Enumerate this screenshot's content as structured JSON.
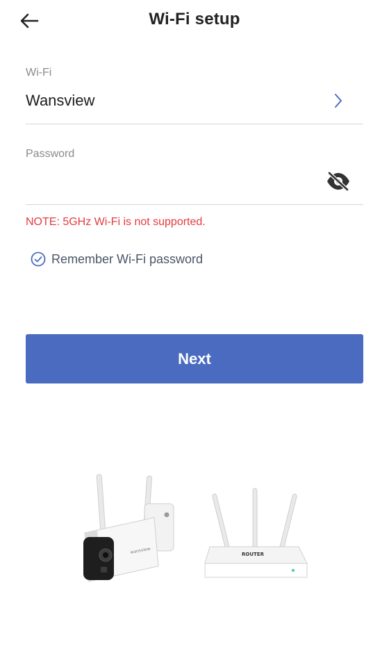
{
  "header": {
    "title": "Wi-Fi setup"
  },
  "wifi": {
    "label": "Wi-Fi",
    "value": "Wansview"
  },
  "password": {
    "label": "Password",
    "value": ""
  },
  "note": "NOTE: 5GHz Wi-Fi is not supported.",
  "remember": {
    "label": "Remember Wi-Fi password",
    "checked": true
  },
  "next_button": {
    "label": "Next"
  },
  "illustration": {
    "camera_brand": "wansview",
    "router_text": "ROUTER"
  },
  "colors": {
    "accent": "#4b6bc1",
    "warning": "#e43a3f",
    "divider": "#d6d6d6",
    "check": "#4b6bc1"
  },
  "icons": [
    "back-arrow-icon",
    "chevron-right-icon",
    "eye-off-icon",
    "check-circle-icon"
  ]
}
